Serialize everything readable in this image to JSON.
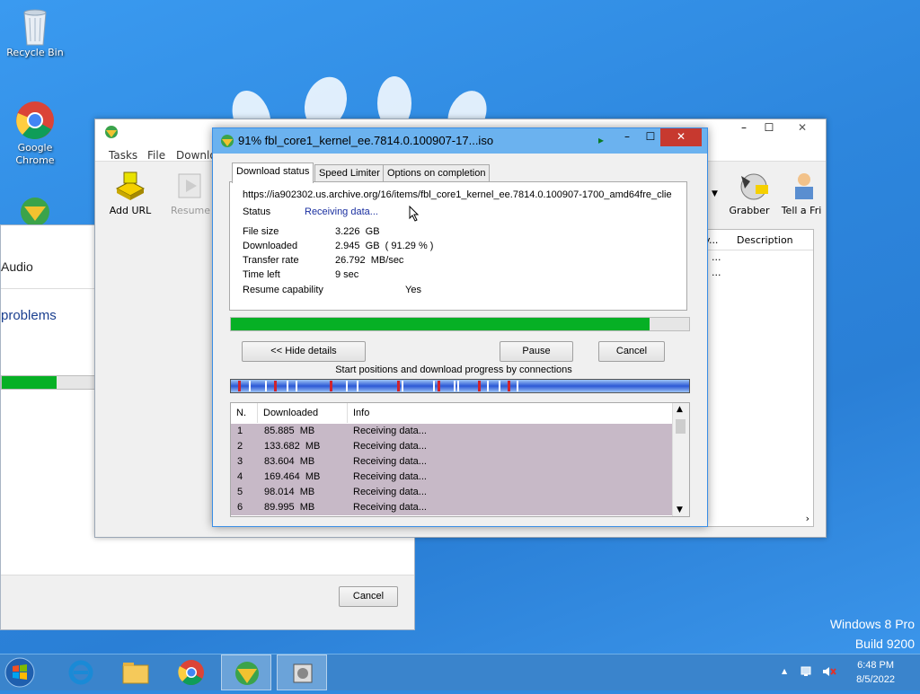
{
  "desktop": {
    "icons": [
      {
        "label": "Recycle Bin"
      },
      {
        "label": "Google Chrome"
      },
      {
        "label": ""
      }
    ],
    "watermark_line1": "Windows 8 Pro",
    "watermark_line2": "Build 9200"
  },
  "bg_installer": {
    "heading": "Audio",
    "subheading": "problems",
    "progress_fraction": 0.26,
    "cancel_label": "Cancel"
  },
  "idm_main": {
    "menu": [
      "Tasks",
      "File",
      "Downlo"
    ],
    "toolbar": {
      "add_url": "Add URL",
      "resume": "Resume",
      "grabber": "Grabber",
      "tell_friend": "Tell a Fri"
    },
    "list_header": {
      "col_partial": "y...",
      "description": "Description"
    },
    "list_rows": [
      "...",
      "..."
    ]
  },
  "dialog": {
    "title": "91% fbl_core1_kernel_ee.7814.0.100907-17...iso",
    "tabs": [
      "Download status",
      "Speed Limiter",
      "Options on completion"
    ],
    "url": "https://ia902302.us.archive.org/16/items/fbl_core1_kernel_ee.7814.0.100907-1700_amd64fre_clie",
    "status_label": "Status",
    "status_value": "Receiving data...",
    "file_size_label": "File size",
    "file_size_value": "3.226  GB",
    "downloaded_label": "Downloaded",
    "downloaded_value": "2.945  GB  ( 91.29 % )",
    "transfer_rate_label": "Transfer rate",
    "transfer_rate_value": "26.792  MB/sec",
    "time_left_label": "Time left",
    "time_left_value": "9 sec",
    "resume_label": "Resume capability",
    "resume_value": "Yes",
    "progress_fraction": 0.9129,
    "hide_details_label": "<< Hide details",
    "pause_label": "Pause",
    "cancel_label": "Cancel",
    "connections_caption": "Start positions and download progress by connections",
    "table_headers": [
      "N.",
      "Downloaded",
      "Info"
    ],
    "connections": [
      {
        "n": "1",
        "downloaded": "85.885  MB",
        "info": "Receiving data..."
      },
      {
        "n": "2",
        "downloaded": "133.682  MB",
        "info": "Receiving data..."
      },
      {
        "n": "3",
        "downloaded": "83.604  MB",
        "info": "Receiving data..."
      },
      {
        "n": "4",
        "downloaded": "169.464  MB",
        "info": "Receiving data..."
      },
      {
        "n": "5",
        "downloaded": "98.014  MB",
        "info": "Receiving data..."
      },
      {
        "n": "6",
        "downloaded": "89.995  MB",
        "info": "Receiving data..."
      }
    ]
  },
  "taskbar": {
    "items": [
      "start",
      "internet-explorer",
      "file-explorer",
      "chrome",
      "idm",
      "installer"
    ],
    "time": "6:48 PM",
    "date": "8/5/2022"
  },
  "colors": {
    "progress_green": "#06b025",
    "title_active": "#6bb2ef",
    "close_red": "#c7392f",
    "row_highlight": "#c7b9c7"
  }
}
